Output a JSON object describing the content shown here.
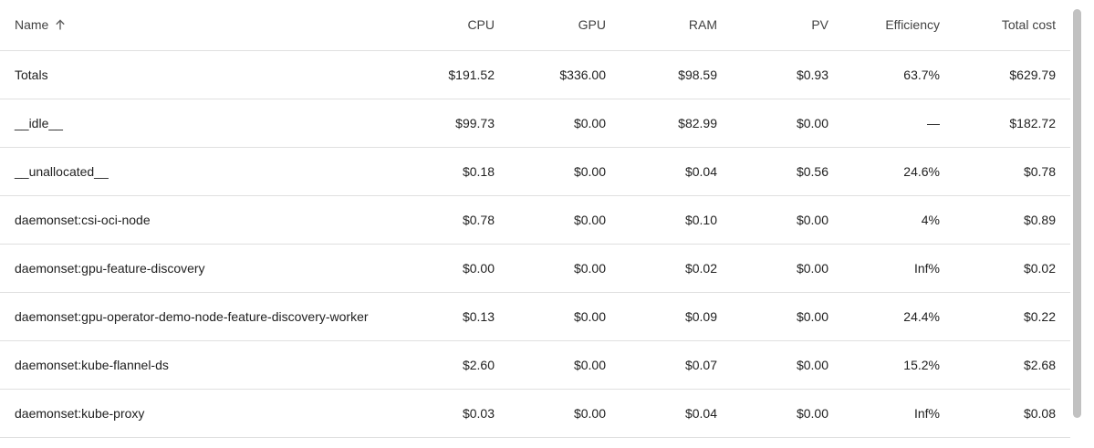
{
  "table": {
    "columns": [
      "Name",
      "CPU",
      "GPU",
      "RAM",
      "PV",
      "Efficiency",
      "Total cost"
    ],
    "sort_icon": "arrow-up-icon",
    "rows": [
      {
        "name": "Totals",
        "cpu": "$191.52",
        "gpu": "$336.00",
        "ram": "$98.59",
        "pv": "$0.93",
        "efficiency": "63.7%",
        "total": "$629.79"
      },
      {
        "name": "__idle__",
        "cpu": "$99.73",
        "gpu": "$0.00",
        "ram": "$82.99",
        "pv": "$0.00",
        "efficiency": "—",
        "total": "$182.72"
      },
      {
        "name": "__unallocated__",
        "cpu": "$0.18",
        "gpu": "$0.00",
        "ram": "$0.04",
        "pv": "$0.56",
        "efficiency": "24.6%",
        "total": "$0.78"
      },
      {
        "name": "daemonset:csi-oci-node",
        "cpu": "$0.78",
        "gpu": "$0.00",
        "ram": "$0.10",
        "pv": "$0.00",
        "efficiency": "4%",
        "total": "$0.89"
      },
      {
        "name": "daemonset:gpu-feature-discovery",
        "cpu": "$0.00",
        "gpu": "$0.00",
        "ram": "$0.02",
        "pv": "$0.00",
        "efficiency": "Inf%",
        "total": "$0.02"
      },
      {
        "name": "daemonset:gpu-operator-demo-node-feature-discovery-worker",
        "cpu": "$0.13",
        "gpu": "$0.00",
        "ram": "$0.09",
        "pv": "$0.00",
        "efficiency": "24.4%",
        "total": "$0.22"
      },
      {
        "name": "daemonset:kube-flannel-ds",
        "cpu": "$2.60",
        "gpu": "$0.00",
        "ram": "$0.07",
        "pv": "$0.00",
        "efficiency": "15.2%",
        "total": "$2.68"
      },
      {
        "name": "daemonset:kube-proxy",
        "cpu": "$0.03",
        "gpu": "$0.00",
        "ram": "$0.04",
        "pv": "$0.00",
        "efficiency": "Inf%",
        "total": "$0.08"
      }
    ]
  }
}
